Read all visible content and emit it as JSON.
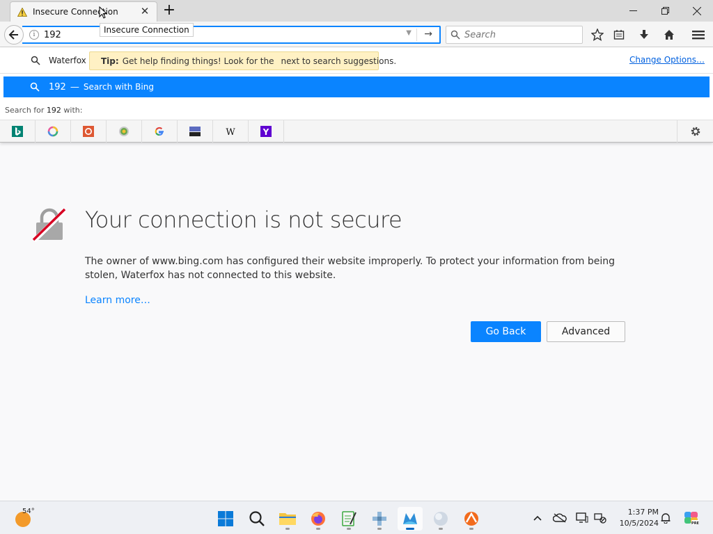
{
  "window": {
    "tab_title": "Insecure Connection",
    "tooltip": "Insecure Connection",
    "controls": [
      "minimize",
      "restore",
      "close"
    ]
  },
  "navbar": {
    "url_value": "192",
    "search_placeholder": "Search"
  },
  "popup": {
    "engine_name": "Waterfox",
    "tip_bold": "Tip:",
    "tip_text_before": "Get help finding things! Look for the",
    "tip_text_after": "next to search suggestions.",
    "change_options": "Change Options…",
    "suggestion_query": "192",
    "suggestion_dash": "—",
    "suggestion_action": "Search with Bing",
    "search_for_prefix": "Search for",
    "search_for_query": "192",
    "search_for_suffix": "with:",
    "engines": [
      "bing-icon",
      "ecosia-icon",
      "duckduckgo-icon",
      "startpage-icon",
      "google-icon",
      "qwant-icon",
      "wikipedia-icon",
      "yahoo-icon"
    ]
  },
  "error_page": {
    "title": "Your connection is not secure",
    "description": "The owner of www.bing.com has configured their website improperly. To protect your information from being stolen, Waterfox has not connected to this website.",
    "learn_more": "Learn more…",
    "go_back": "Go Back",
    "advanced": "Advanced"
  },
  "taskbar": {
    "weather_temp": "54°",
    "time": "1:37 PM",
    "date": "10/5/2024",
    "apps": [
      "start-icon",
      "search-icon",
      "file-explorer-icon",
      "firefox-icon",
      "notepad-icon",
      "app-icon",
      "waterfox-icon",
      "globe-icon",
      "app-orange-icon"
    ]
  },
  "colors": {
    "accent": "#0a84ff",
    "tip_bg": "#fff1c4",
    "lock_red": "#d70022"
  }
}
